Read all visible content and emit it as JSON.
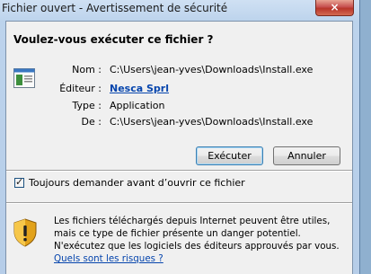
{
  "window": {
    "title": "Fichier ouvert - Avertissement de sécurité",
    "close_symbol": "×"
  },
  "dialog": {
    "heading": "Voulez-vous exécuter ce fichier ?",
    "fields": [
      {
        "label": "Nom :",
        "value": "C:\\Users\\jean-yves\\Downloads\\Install.exe"
      },
      {
        "label": "Éditeur :",
        "value": "Nesca Sprl"
      },
      {
        "label": "Type :",
        "value": "Application"
      },
      {
        "label": "De :",
        "value": "C:\\Users\\jean-yves\\Downloads\\Install.exe"
      }
    ],
    "buttons": {
      "run": "Exécuter",
      "cancel": "Annuler"
    },
    "checkbox": {
      "label": "Toujours demander avant d’ouvrir ce fichier",
      "checked": true
    },
    "warning": {
      "text": "Les fichiers téléchargés depuis Internet peuvent être utiles, mais ce type de fichier présente un danger potentiel. N'exécutez que les logiciels des éditeurs approuvés par vous. ",
      "link": "Quels sont les risques ?"
    }
  }
}
